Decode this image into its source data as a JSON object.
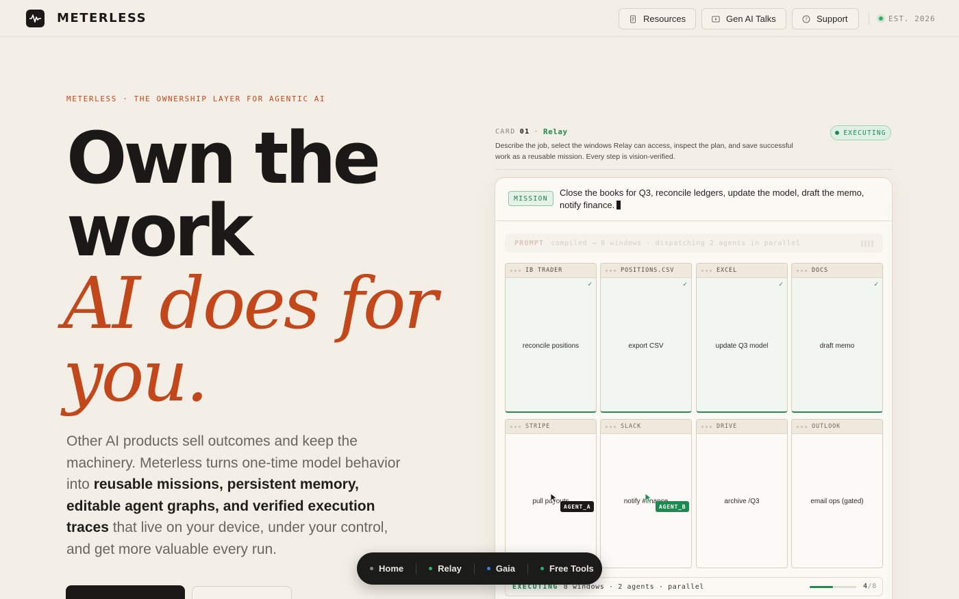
{
  "header": {
    "brand": "METERLESS",
    "nav": [
      {
        "label": "Resources",
        "icon": "document-icon"
      },
      {
        "label": "Gen AI Talks",
        "icon": "play-icon"
      },
      {
        "label": "Support",
        "icon": "help-circle-icon"
      }
    ],
    "established": "EST. 2026",
    "status_color": "#2fae6b"
  },
  "hero": {
    "eyebrow": "METERLESS · THE OWNERSHIP LAYER FOR AGENTIC AI",
    "headline_line1": "Own the",
    "headline_line2": "work",
    "headline_italic_line1": "AI does for",
    "headline_italic_line2": "you.",
    "lede_parts": [
      {
        "text": "Other AI products sell outcomes and keep the machinery. Meterless turns one-time model behavior into "
      },
      {
        "text": "reusable missions, persistent memory, editable agent graphs, and verified execution traces"
      },
      {
        "text": " that live on your device, under your control, and get more valuable every run."
      }
    ],
    "accent_color": "#c2481b"
  },
  "card": {
    "label": "CARD",
    "number": "01",
    "separator": "·",
    "name": "Relay",
    "status": "EXECUTING",
    "description": "Describe the job, select the windows Relay can access, inspect the plan, and save successful work as a reusable mission. Every step is vision-verified.",
    "mission_tag": "MISSION",
    "mission_text": "Close the books for Q3, reconcile ledgers, update the model, draft the memo, notify finance.",
    "prompt_label": "PROMPT",
    "prompt_text": "compiled → 8 windows · dispatching 2 agents in parallel",
    "windows": [
      {
        "title": "IB TRADER",
        "task": "reconcile positions",
        "done": true
      },
      {
        "title": "POSITIONS.CSV",
        "task": "export CSV",
        "done": true
      },
      {
        "title": "EXCEL",
        "task": "update Q3 model",
        "done": true
      },
      {
        "title": "DOCS",
        "task": "draft memo",
        "done": true
      },
      {
        "title": "STRIPE",
        "task": "pull payouts",
        "done": false,
        "agent": "AGENT_A"
      },
      {
        "title": "SLACK",
        "task": "notify #finance",
        "done": false,
        "agent": "AGENT_B"
      },
      {
        "title": "DRIVE",
        "task": "archive /Q3",
        "done": false
      },
      {
        "title": "OUTLOOK",
        "task": "email ops (gated)",
        "done": false
      }
    ],
    "footer_status": "EXECUTING",
    "footer_text": "8 windows · 2 agents · parallel",
    "progress_done": "4",
    "progress_total": "/8",
    "progress_fraction": 0.5
  },
  "dock": {
    "items": [
      {
        "label": "Home",
        "dot": "#8a8780"
      },
      {
        "label": "Relay",
        "dot": "#2fae6b"
      },
      {
        "label": "Gaia",
        "dot": "#3f7fe0"
      },
      {
        "label": "Free Tools",
        "dot": "#2fae6b"
      }
    ]
  }
}
